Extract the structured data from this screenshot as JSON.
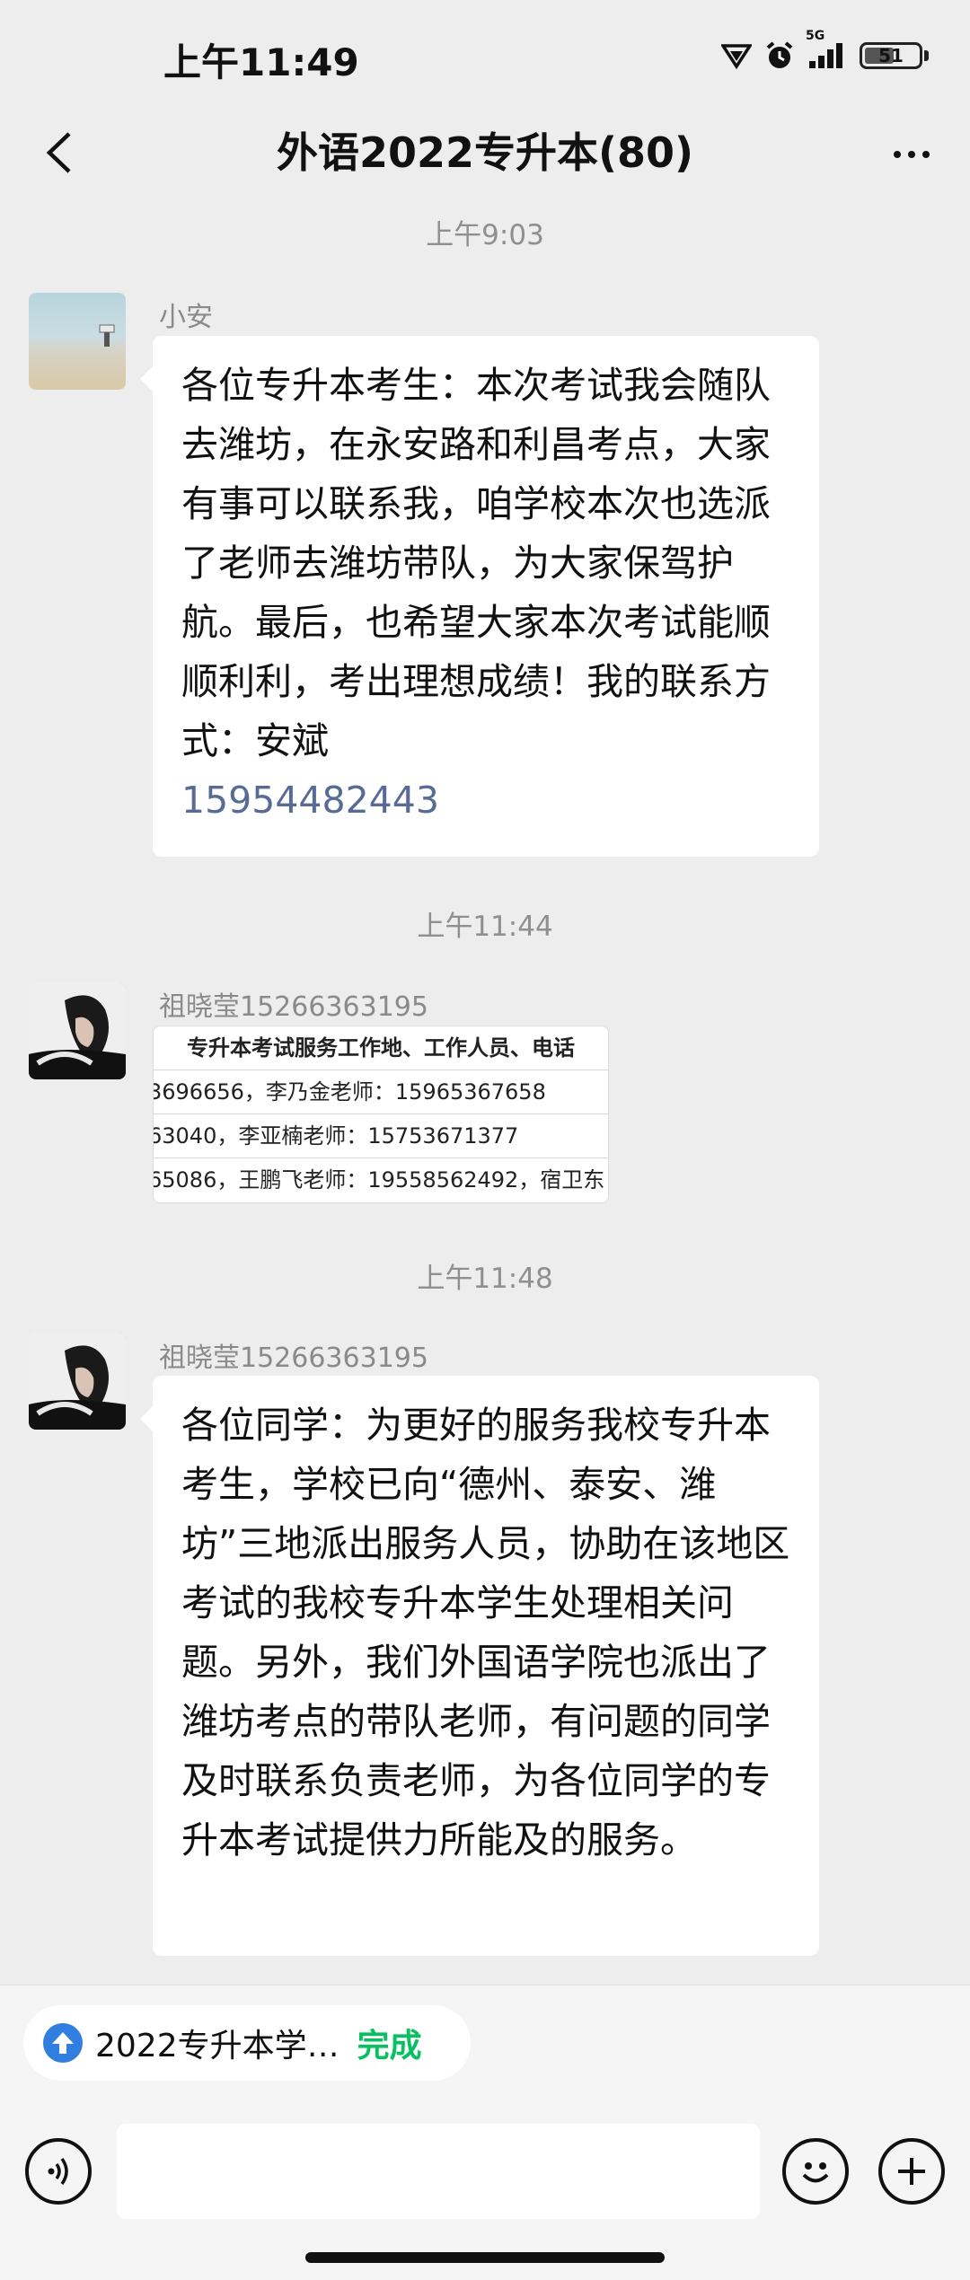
{
  "status_bar": {
    "time": "上午11:49",
    "network": "5G",
    "battery": "51"
  },
  "header": {
    "title": "外语2022专升本(80)"
  },
  "messages": [
    {
      "timestamp": "上午9:03",
      "sender": "小安",
      "text": "各位专升本考生：本次考试我会随队去潍坊，在永安路和利昌考点，大家有事可以联系我，咱学校本次也选派了老师去潍坊带队，为大家保驾护航。最后，也希望大家本次考试能顺顺利利，考出理想成绩！我的联系方式：安斌",
      "phone": "15954482443"
    },
    {
      "timestamp": "上午11:44",
      "sender": "祖晓莹15266363195",
      "image": {
        "header": "专升本考试服务工作地、工作人员、电话",
        "rows": [
          "3696656，李乃金老师：15965367658",
          "63040，李亚楠老师：15753671377",
          "65086，王鹏飞老师：19558562492，宿卫东"
        ]
      }
    },
    {
      "timestamp": "上午11:48",
      "sender": "祖晓莹15266363195",
      "text": "各位同学：为更好的服务我校专升本考生，学校已向“德州、泰安、潍坊”三地派出服务人员，协助在该地区考试的我校专升本学生处理相关问题。另外，我们外国语学院也派出了潍坊考点的带队老师，有问题的同学及时联系负责老师，为各位同学的专升本考试提供力所能及的服务。"
    }
  ],
  "bottom_bar": {
    "pill_text": "2022专升本学…",
    "pill_action": "完成"
  }
}
